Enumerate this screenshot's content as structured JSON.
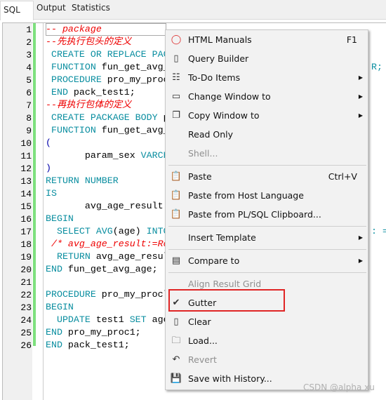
{
  "tabs": [
    {
      "label": "SQL",
      "active": true
    },
    {
      "label": "Output"
    },
    {
      "label": "Statistics"
    }
  ],
  "editor": {
    "lines": [
      {
        "n": "1",
        "parts": [
          {
            "t": "-- package",
            "c": "cm"
          }
        ]
      },
      {
        "n": "2",
        "parts": [
          {
            "t": "--先执行包头的定义",
            "c": "cm"
          }
        ]
      },
      {
        "n": "3",
        "parts": [
          {
            "t": " CREATE OR REPLACE PAC",
            "c": "kw"
          }
        ]
      },
      {
        "n": "4",
        "parts": [
          {
            "t": " FUNCTION",
            "c": "kw"
          },
          {
            "t": " fun_get_avg_",
            "c": ""
          }
        ],
        "right": "R;"
      },
      {
        "n": "5",
        "parts": [
          {
            "t": " PROCEDURE",
            "c": "kw"
          },
          {
            "t": " pro_my_proc",
            "c": ""
          }
        ]
      },
      {
        "n": "6",
        "parts": [
          {
            "t": " END",
            "c": "kw"
          },
          {
            "t": " pack_test1;",
            "c": ""
          }
        ]
      },
      {
        "n": "7",
        "parts": [
          {
            "t": "--再执行包体的定义",
            "c": "cm"
          }
        ]
      },
      {
        "n": "8",
        "parts": [
          {
            "t": " CREATE PACKAGE BODY",
            "c": "kw"
          },
          {
            "t": " p",
            "c": ""
          }
        ]
      },
      {
        "n": "9",
        "parts": [
          {
            "t": " FUNCTION",
            "c": "kw"
          },
          {
            "t": " fun_get_avg_",
            "c": ""
          }
        ]
      },
      {
        "n": "10",
        "parts": [
          {
            "t": "(",
            "c": "pn"
          }
        ]
      },
      {
        "n": "11",
        "parts": [
          {
            "t": "       param_sex ",
            "c": ""
          },
          {
            "t": "VARCH",
            "c": "kw"
          }
        ]
      },
      {
        "n": "12",
        "parts": [
          {
            "t": ")",
            "c": "pn"
          }
        ]
      },
      {
        "n": "13",
        "parts": [
          {
            "t": "RETURN NUMBER",
            "c": "kw"
          }
        ]
      },
      {
        "n": "14",
        "parts": [
          {
            "t": "IS",
            "c": "kw"
          }
        ]
      },
      {
        "n": "15",
        "parts": [
          {
            "t": "       avg_age_result",
            "c": ""
          }
        ]
      },
      {
        "n": "16",
        "parts": [
          {
            "t": "BEGIN",
            "c": "kw"
          }
        ]
      },
      {
        "n": "17",
        "parts": [
          {
            "t": "  SELECT AVG",
            "c": "kw"
          },
          {
            "t": "(age) ",
            "c": ""
          },
          {
            "t": "INTO",
            "c": "kw"
          }
        ],
        "right": ": ="
      },
      {
        "n": "18",
        "parts": [
          {
            "t": " /* avg_age_result:=Ro",
            "c": "cm"
          }
        ]
      },
      {
        "n": "19",
        "parts": [
          {
            "t": "  RETURN",
            "c": "kw"
          },
          {
            "t": " avg_age_resul",
            "c": ""
          }
        ]
      },
      {
        "n": "20",
        "parts": [
          {
            "t": "END",
            "c": "kw"
          },
          {
            "t": " fun_get_avg_age;",
            "c": ""
          }
        ]
      },
      {
        "n": "21",
        "parts": []
      },
      {
        "n": "22",
        "parts": [
          {
            "t": "PROCEDURE",
            "c": "kw"
          },
          {
            "t": " pro_my_procl",
            "c": ""
          }
        ]
      },
      {
        "n": "23",
        "parts": [
          {
            "t": "BEGIN",
            "c": "kw"
          }
        ]
      },
      {
        "n": "24",
        "parts": [
          {
            "t": "  UPDATE",
            "c": "kw"
          },
          {
            "t": " test1 ",
            "c": ""
          },
          {
            "t": "SET",
            "c": "kw"
          },
          {
            "t": " age",
            "c": ""
          }
        ]
      },
      {
        "n": "25",
        "parts": [
          {
            "t": "END",
            "c": "kw"
          },
          {
            "t": " pro_my_proc1;",
            "c": ""
          }
        ]
      },
      {
        "n": "26",
        "parts": [
          {
            "t": "END",
            "c": "kw"
          },
          {
            "t": " pack_test1;",
            "c": ""
          }
        ]
      }
    ]
  },
  "menu": {
    "items": [
      {
        "label": "HTML Manuals",
        "shortcut": "F1",
        "icon": "help-manual-icon",
        "g": "◯"
      },
      {
        "label": "Query Builder",
        "icon": "sql-file-icon",
        "g": "▯"
      },
      {
        "label": "To-Do Items",
        "submenu": true,
        "icon": "clipboard-list-icon",
        "g": "☷"
      },
      {
        "label": "Change Window to",
        "submenu": true,
        "icon": "window-icon",
        "g": "▭"
      },
      {
        "label": "Copy Window to",
        "submenu": true,
        "icon": "windows-copy-icon",
        "g": "❐"
      },
      {
        "label": "Read Only"
      },
      {
        "label": "Shell...",
        "disabled": true,
        "sepAfter": true
      },
      {
        "label": "Paste",
        "shortcut": "Ctrl+V",
        "icon": "paste-icon",
        "g": "📋"
      },
      {
        "label": "Paste from Host Language",
        "icon": "paste-host-icon",
        "g": "📋"
      },
      {
        "label": "Paste from PL/SQL Clipboard...",
        "icon": "paste-plsql-icon",
        "g": "📋",
        "sepAfter": true
      },
      {
        "label": "Insert Template",
        "submenu": true,
        "sepAfter": true
      },
      {
        "label": "Compare to",
        "submenu": true,
        "icon": "compare-icon",
        "g": "▤",
        "sepAfter": true
      },
      {
        "label": "Align Result Grid",
        "disabled": true
      },
      {
        "label": "Gutter",
        "checked": true,
        "icon": "checkmark-icon",
        "g": "✔"
      },
      {
        "label": "Clear",
        "icon": "blank-page-icon",
        "g": "▯"
      },
      {
        "label": "Load...",
        "icon": "folder-icon",
        "g": "🗀"
      },
      {
        "label": "Revert",
        "disabled": true,
        "icon": "undo-icon",
        "g": "↶"
      },
      {
        "label": "Save with History...",
        "icon": "save-icon",
        "g": "💾"
      }
    ]
  },
  "watermark": "CSDN @alpha xu"
}
